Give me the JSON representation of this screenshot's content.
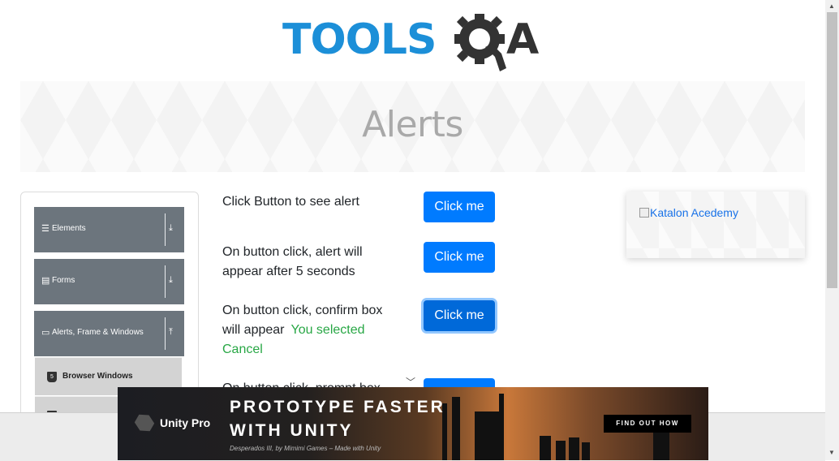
{
  "header": {
    "logo_text_primary": "TOOLS",
    "logo_text_secondary": "A"
  },
  "banner": {
    "title": "Alerts"
  },
  "sidebar": {
    "groups": [
      {
        "label": "Elements",
        "icon": "hamburger-icon",
        "state": "collapsed"
      },
      {
        "label": "Forms",
        "icon": "form-icon",
        "state": "collapsed"
      },
      {
        "label": "Alerts, Frame & Windows",
        "icon": "window-icon",
        "state": "expanded"
      }
    ],
    "items": [
      {
        "label": "Browser Windows",
        "icon": "html5-icon"
      }
    ]
  },
  "alerts": {
    "rows": [
      {
        "label": "Click Button to see alert",
        "button": "Click me"
      },
      {
        "label": "On button click, alert will appear after 5 seconds",
        "button": "Click me"
      },
      {
        "label": "On button click, confirm box will appear",
        "button": "Click me",
        "result": "You selected Cancel"
      },
      {
        "label": "On button click, prompt box",
        "button": ""
      }
    ]
  },
  "side_ad": {
    "alt_text": "Katalon Acedemy"
  },
  "ad": {
    "brand": "Unity Pro",
    "headline_line1": "PROTOTYPE FASTER",
    "headline_line2": "WITH UNITY",
    "credit": "Desperados III, by Mimimi Games – Made with Unity",
    "cta": "FIND OUT HOW"
  },
  "colors": {
    "brand_blue": "#1c8fd8",
    "logo_dark": "#333333",
    "primary_button": "#007bff",
    "success_text": "#28a745",
    "sidebar_group": "#6c757d"
  }
}
